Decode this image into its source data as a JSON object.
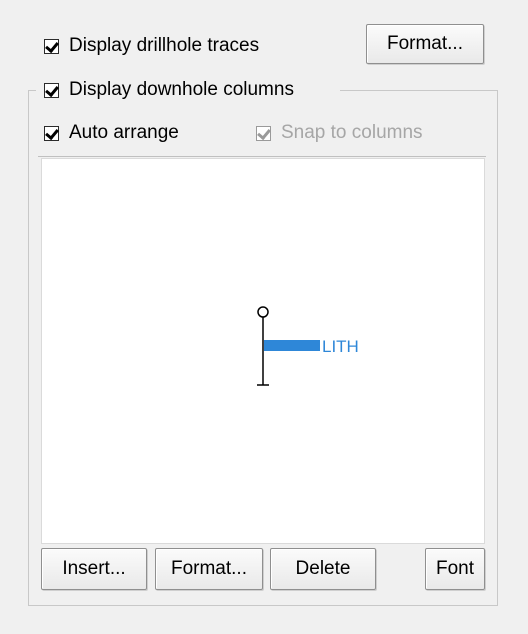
{
  "checkboxes": {
    "display_traces": {
      "label": "Display drillhole traces",
      "checked": true
    },
    "display_columns": {
      "label": "Display downhole columns",
      "checked": true
    },
    "auto_arrange": {
      "label": "Auto arrange",
      "checked": true
    },
    "snap_columns": {
      "label": "Snap to columns",
      "checked": true,
      "disabled": true
    }
  },
  "buttons": {
    "format_top": "Format...",
    "insert": "Insert...",
    "format": "Format...",
    "delete": "Delete",
    "font": "Font"
  },
  "preview": {
    "column_label": "LITH",
    "column_color": "#2e87d8"
  }
}
